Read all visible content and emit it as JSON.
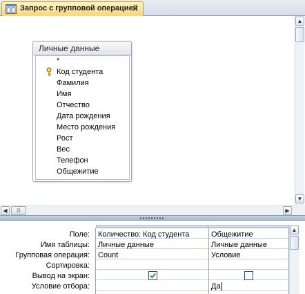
{
  "window": {
    "tab_title": "Запрос с групповой операцией",
    "close_glyph": "✕"
  },
  "table": {
    "title": "Личные данные",
    "fields": [
      "*",
      "Код студента",
      "Фамилия",
      "Имя",
      "Отчество",
      "Дата рождения",
      "Место рождения",
      "Рост",
      "Вес",
      "Телефон",
      "Общежитие"
    ],
    "key_field": "Код студента"
  },
  "scroll": {
    "up": "▲",
    "down": "▼",
    "left": "◀",
    "right": "▶",
    "hthumb_glyph": "|||"
  },
  "grid": {
    "row_labels": [
      "Поле:",
      "Имя таблицы:",
      "Групповая операция:",
      "Сортировка:",
      "Вывод на экран:",
      "Условие отбора:"
    ],
    "columns": [
      {
        "field": "Количество: Код студента",
        "table": "Личные данные",
        "group_op": "Count",
        "sort": "",
        "show": true,
        "criteria": ""
      },
      {
        "field": "Общежитие",
        "table": "Личные данные",
        "group_op": "Условие",
        "sort": "",
        "show": false,
        "criteria": "Да"
      }
    ]
  },
  "colors": {
    "tab_active": "#f7d67a",
    "checkbox_check": "#2a8a2a"
  }
}
